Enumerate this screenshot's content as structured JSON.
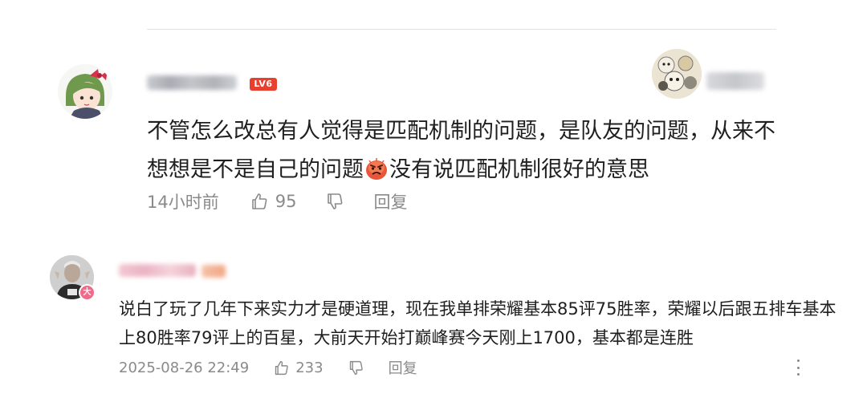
{
  "comment1": {
    "level_badge": "LV6",
    "text_before_emoji": "不管怎么改总有人觉得是匹配机制的问题，是队友的问题，从来不想想是不是自己的问题",
    "emoji": "angry-face-sticker",
    "text_after_emoji": "没有说匹配机制很好的意思",
    "time": "14小时前",
    "like_count": "95",
    "reply_label": "回复"
  },
  "comment2": {
    "avatar_badge": "大",
    "text": "说白了玩了几年下来实力才是硬道理，现在我单排荣耀基本85评75胜率，荣耀以后跟五排车基本上80胜率79评上的百星，大前天开始打巅峰赛今天刚上1700，基本都是连胜",
    "time": "2025-08-26 22:49",
    "like_count": "233",
    "reply_label": "回复"
  },
  "colors": {
    "level_badge_bg": "#e8402f",
    "meta_text": "#8a8a8a",
    "body_text": "#1f1f1f"
  }
}
